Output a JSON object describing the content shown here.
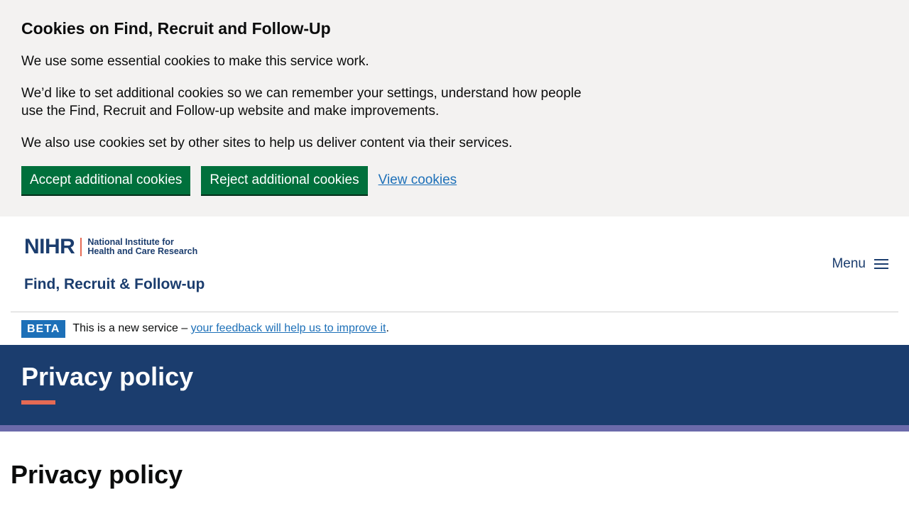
{
  "cookie_banner": {
    "title": "Cookies on Find, Recruit and Follow-Up",
    "paragraphs": [
      "We use some essential cookies to make this service work.",
      "We’d like to set additional cookies so we can remember your settings, understand how people use the Find, Recruit and Follow-up website and make improvements.",
      "We also use cookies set by other sites to help us deliver content via their services."
    ],
    "accept_label": "Accept additional cookies",
    "reject_label": "Reject additional cookies",
    "view_link": "View cookies"
  },
  "header": {
    "logo_mark": "NIHR",
    "logo_sub_line1": "National Institute for",
    "logo_sub_line2": "Health and Care Research",
    "service_name": "Find, Recruit & Follow-up",
    "menu_label": "Menu"
  },
  "phase_banner": {
    "tag": "BETA",
    "text_before": "This is a new service – ",
    "link_text": "your feedback will help us to improve it",
    "text_after": "."
  },
  "hero": {
    "title": "Privacy policy"
  },
  "main": {
    "heading": "Privacy policy"
  },
  "colors": {
    "brand_navy": "#1b3d6e",
    "accent_coral": "#e56a54",
    "strip_purple": "#6b6aaa",
    "button_green": "#00703c",
    "link_blue": "#1d70b8",
    "banner_grey": "#f3f2f1"
  }
}
